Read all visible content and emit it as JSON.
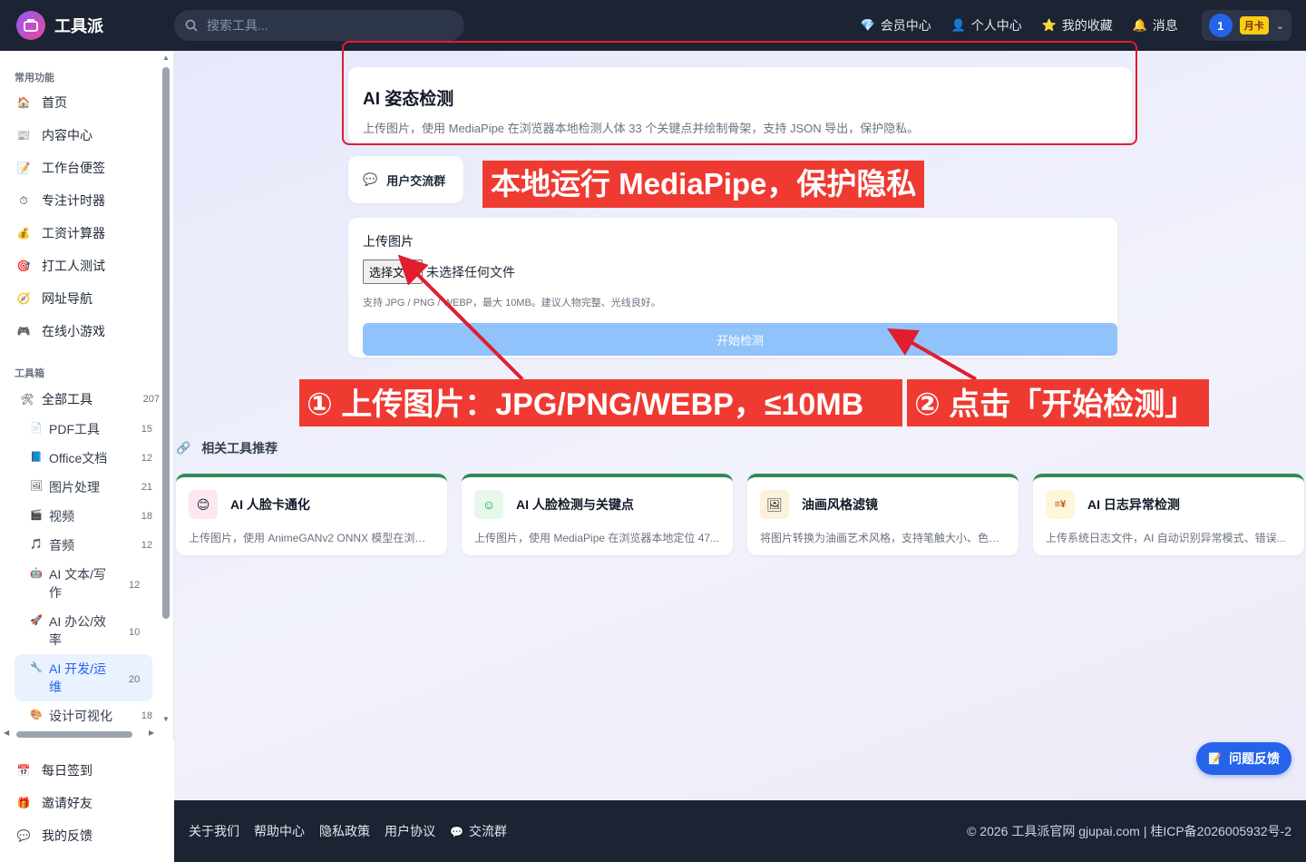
{
  "app": {
    "name": "工具派"
  },
  "search": {
    "placeholder": "搜索工具..."
  },
  "topnav": [
    {
      "label": "会员中心",
      "icon": "diamond-icon",
      "glyph": "💎"
    },
    {
      "label": "个人中心",
      "icon": "user-icon",
      "glyph": "👤"
    },
    {
      "label": "我的收藏",
      "icon": "star-icon",
      "glyph": "⭐"
    },
    {
      "label": "消息",
      "icon": "bell-icon",
      "glyph": "🔔"
    }
  ],
  "user": {
    "avatar": "1",
    "badge": "月卡"
  },
  "sidebar": {
    "section_common": "常用功能",
    "common": [
      {
        "label": "首页",
        "glyph": "🏠"
      },
      {
        "label": "内容中心",
        "glyph": "📰"
      },
      {
        "label": "工作台便签",
        "glyph": "📝"
      },
      {
        "label": "专注计时器",
        "glyph": "⏱"
      },
      {
        "label": "工资计算器",
        "glyph": "💰"
      },
      {
        "label": "打工人测试",
        "glyph": "🎯"
      },
      {
        "label": "网址导航",
        "glyph": "🧭"
      },
      {
        "label": "在线小游戏",
        "glyph": "🎮"
      }
    ],
    "section_tools": "工具箱",
    "all_tools": {
      "label": "全部工具",
      "count": "207",
      "glyph": "🛠"
    },
    "tools": [
      {
        "label": "PDF工具",
        "count": "15",
        "glyph": "📄"
      },
      {
        "label": "Office文档",
        "count": "12",
        "glyph": "📘"
      },
      {
        "label": "图片处理",
        "count": "21",
        "glyph": "🖼"
      },
      {
        "label": "视频",
        "count": "18",
        "glyph": "🎬"
      },
      {
        "label": "音频",
        "count": "12",
        "glyph": "🎵"
      },
      {
        "label": "AI 文本/写作",
        "count": "12",
        "glyph": "🤖"
      },
      {
        "label": "AI 办公/效率",
        "count": "10",
        "glyph": "🚀"
      },
      {
        "label": "AI 开发/运维",
        "count": "20",
        "glyph": "🔧"
      },
      {
        "label": "设计可视化",
        "count": "18",
        "glyph": "🎨"
      }
    ],
    "bottom": [
      {
        "label": "每日签到",
        "glyph": "📅"
      },
      {
        "label": "邀请好友",
        "glyph": "🎁"
      },
      {
        "label": "我的反馈",
        "glyph": "💬"
      }
    ]
  },
  "hero": {
    "title": "AI 姿态检测",
    "desc": "上传图片，使用 MediaPipe 在浏览器本地检测人体 33 个关键点并绘制骨架，支持 JSON 导出，保护隐私。"
  },
  "group_button": {
    "label": "用户交流群",
    "glyph": "💬"
  },
  "callouts": {
    "privacy": "本地运行 MediaPipe，保护隐私",
    "step1": "① 上传图片：JPG/PNG/WEBP，≤10MB",
    "step2": "② 点击「开始检测」"
  },
  "upload": {
    "label": "上传图片",
    "choose_button": "选择文件",
    "no_file": "未选择任何文件",
    "hint": "支持 JPG / PNG / WEBP，最大 10MB。建议人物完整、光线良好。",
    "start_button": "开始检测"
  },
  "related": {
    "title": "相关工具推荐",
    "glyph": "🔗",
    "items": [
      {
        "name": "AI 人脸卡通化",
        "desc": "上传图片，使用 AnimeGANv2 ONNX 模型在浏览...",
        "glyph": "😊",
        "bg": "#fde8f1"
      },
      {
        "name": "AI 人脸检测与关键点",
        "desc": "上传图片，使用 MediaPipe 在浏览器本地定位 47...",
        "glyph": "☺",
        "bg": "#e6f7ec"
      },
      {
        "name": "油画风格滤镜",
        "desc": "将图片转换为油画艺术风格，支持笔触大小、色彩...",
        "glyph": "🖼",
        "bg": "#fdf1dc"
      },
      {
        "name": "AI 日志异常检测",
        "desc": "上传系统日志文件，AI 自动识别异常模式、错误...",
        "glyph": "≡¥",
        "bg": "#fef6d8"
      }
    ]
  },
  "feedback": {
    "label": "问题反馈",
    "glyph": "📝"
  },
  "footer": {
    "links": [
      "关于我们",
      "帮助中心",
      "隐私政策",
      "用户协议",
      "交流群"
    ],
    "group_glyph": "💬",
    "copyright": "© 2026 工具派官网 gjupai.com | 桂ICP备2026005932号-2"
  },
  "colors": {
    "accent": "#2563eb",
    "callout": "#ef3a32",
    "topbar": "#1c2333"
  }
}
